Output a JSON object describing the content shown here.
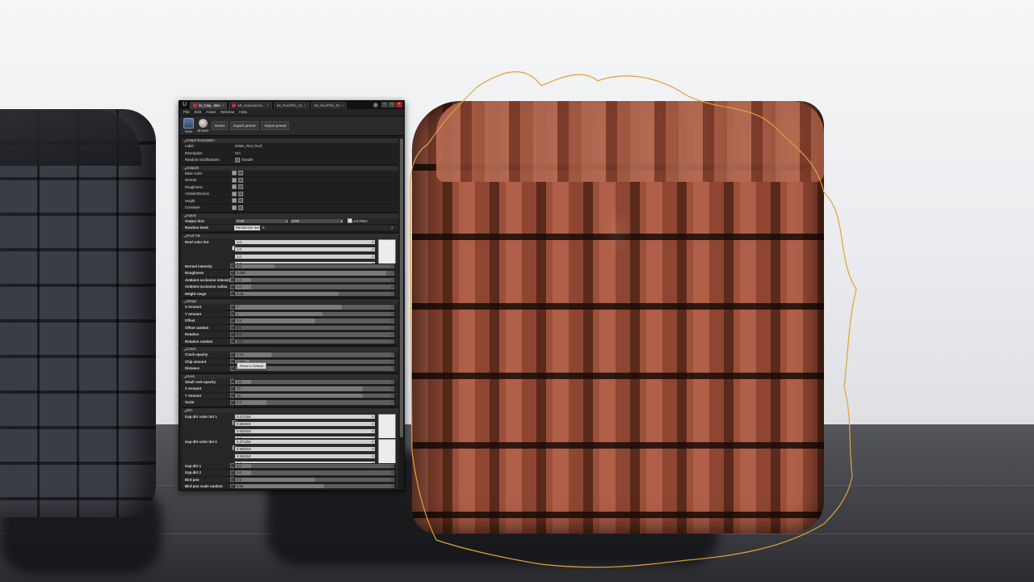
{
  "window": {
    "tabs": [
      {
        "label": "M_Clay...tiles",
        "active": true
      },
      {
        "label": "MI_Galvanized...",
        "active": false
      },
      {
        "label": "MI_RoofTile_01",
        "active": false
      },
      {
        "label": "MI_RoofTile_02",
        "active": false
      }
    ],
    "menu": [
      "File",
      "Edit",
      "Asset",
      "Window",
      "Help"
    ],
    "toolbar": {
      "save": "Save",
      "browse": "Browse",
      "reset": "Reset",
      "export_preset": "Export preset",
      "import_preset": "Import preset"
    }
  },
  "graph_description": {
    "header": "Graph Description",
    "label_key": "Label",
    "label_val": "Italian_Red_Roof",
    "description_key": "Description",
    "description_val": "N/A",
    "random_key": "Random modifications",
    "random_val": "Disable"
  },
  "outputs": {
    "header": "Outputs",
    "items": [
      "Base Color",
      "Normal",
      "Roughness",
      "AmbientOcclusi",
      "Height",
      "Curvature"
    ]
  },
  "inputs": {
    "header": "Inputs",
    "output_size_label": "Output Size",
    "output_size_a": "2048",
    "output_size_b": "2048",
    "lock_ratio": "Lock Ratio",
    "random_seed_label": "Random Seed",
    "randomize_btn": "Randomize Seed",
    "random_seed_val": "0"
  },
  "roof_tile": {
    "header": "Roof Tile",
    "color_tint_label": "Roof color tint",
    "color_tint": [
      "1.0",
      "1.0",
      "1.0",
      "1.0"
    ],
    "rows": [
      {
        "label": "Normal intensity",
        "value": "1.0",
        "fill": 0.25
      },
      {
        "label": "Roughness",
        "value": "0.968",
        "fill": 0.95
      },
      {
        "label": "Ambient occlusion intensity",
        "value": "1.0",
        "fill": 0.1
      },
      {
        "label": "Ambient occlusion radius",
        "value": "1.0",
        "fill": 0.1
      },
      {
        "label": "Height range",
        "value": "0.46",
        "fill": 0.65
      }
    ]
  },
  "shape": {
    "header": "Shape",
    "rows": [
      {
        "label": "X Amount",
        "value": "7",
        "fill": 0.67
      },
      {
        "label": "Y Amount",
        "value": "7",
        "fill": 0.55
      },
      {
        "label": "Offset",
        "value": "0.5",
        "fill": 0.5
      },
      {
        "label": "Offset random",
        "value": "0.0",
        "fill": 0.0
      },
      {
        "label": "Rotation",
        "value": "0.0",
        "fill": 0.0
      },
      {
        "label": "Rotation random",
        "value": "0.01",
        "fill": 0.01
      }
    ]
  },
  "crack": {
    "header": "Crack",
    "rows": [
      {
        "label": "Crack opacity",
        "value": "0.23",
        "fill": 0.23
      },
      {
        "label": "Chip amount",
        "value": "0.092",
        "fill": 0.09
      },
      {
        "label": "Distance",
        "value": "",
        "fill": 0.0
      }
    ],
    "tooltip": "Reset to Default"
  },
  "rock": {
    "header": "Rock",
    "rows": [
      {
        "label": "Small rock opacity",
        "value": "1.0",
        "fill": 0.1
      },
      {
        "label": "X Amount",
        "value": "16",
        "fill": 0.8
      },
      {
        "label": "Y Amount",
        "value": "16",
        "fill": 0.8
      },
      {
        "label": "Scale",
        "value": "0.2",
        "fill": 0.2
      }
    ]
  },
  "dirt": {
    "header": "Dirt",
    "gap1_label": "Gap dirt color tint 1",
    "gap1": [
      "0.371254",
      "0.962819",
      "0.962819",
      "1.0"
    ],
    "gap2_label": "Gap dirt color tint 2",
    "gap2": [
      "0.371254",
      "0.962819",
      "0.962819",
      "1.0"
    ],
    "rows": [
      {
        "label": "Gap dirt 1",
        "value": "1.0",
        "fill": 0.1
      },
      {
        "label": "Gap dirt 2",
        "value": "1.0",
        "fill": 0.1
      },
      {
        "label": "Bird poo",
        "value": "0.5",
        "fill": 0.5
      },
      {
        "label": "Bird poo scale random",
        "value": "0.56",
        "fill": 0.56
      },
      {
        "label": "Bird poo position random",
        "value": "0.51",
        "fill": 0.51
      },
      {
        "label": "Poo amount X",
        "value": "",
        "fill": 0.1
      }
    ]
  },
  "colors": {
    "selection_outline": "#e0a23a",
    "output_swatch": "#9a9a9a"
  }
}
